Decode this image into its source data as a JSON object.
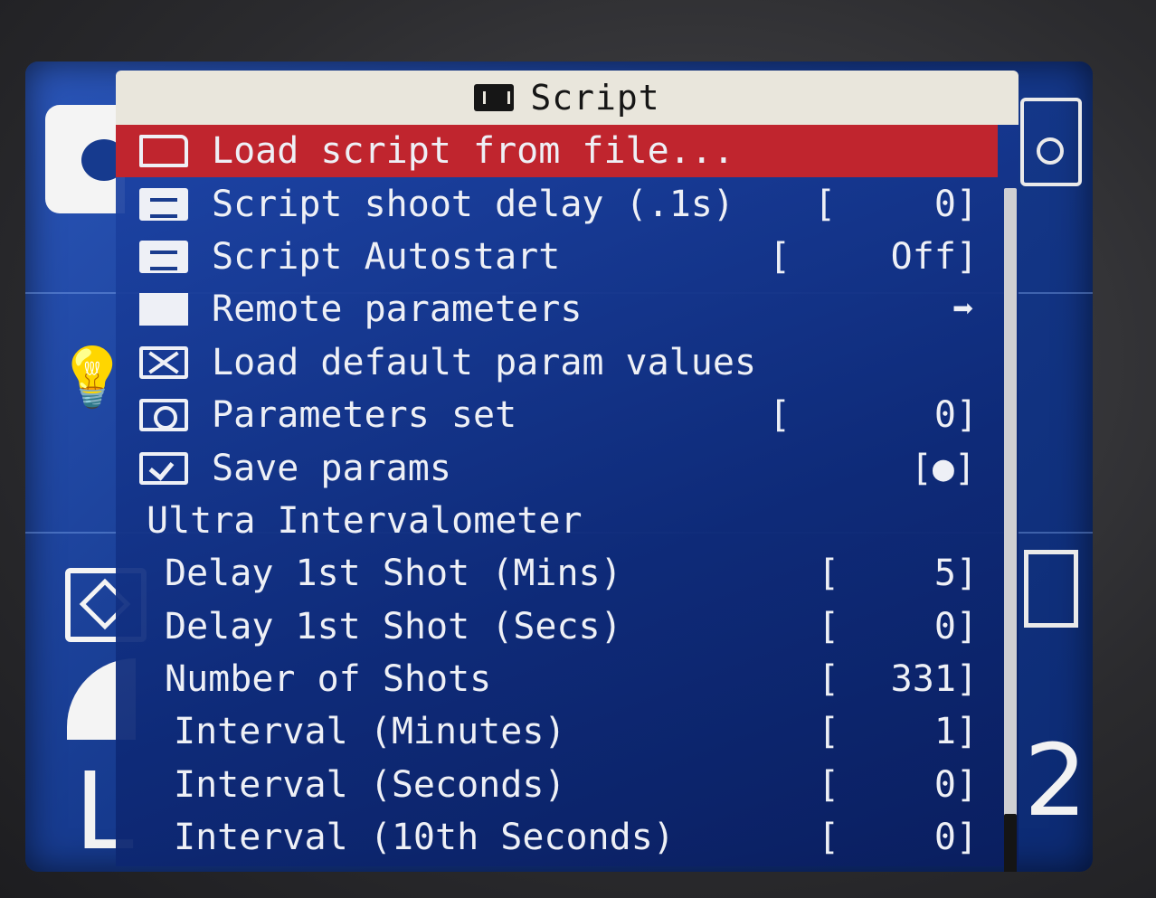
{
  "menu": {
    "title": "Script",
    "title_icon": "script-icon"
  },
  "rows": [
    {
      "label": "Load script from file...",
      "value": "",
      "icon": "folder-icon",
      "selected": true
    },
    {
      "label": "Script shoot delay (.1s)",
      "bracket": "[",
      "value": "0]",
      "icon": "value-icon"
    },
    {
      "label": "Script Autostart",
      "bracket": "[",
      "value": "Off]",
      "icon": "value-icon"
    },
    {
      "label": "Remote parameters",
      "arrow": "➡",
      "icon": "remote-icon"
    },
    {
      "label": "Load default param values",
      "icon": "reset-icon"
    },
    {
      "label": "Parameters set",
      "bracket": "[",
      "value": "0]",
      "icon": "cycle-icon"
    },
    {
      "label": "Save params",
      "value": "[●]",
      "icon": "checkbox-icon"
    },
    {
      "label": "Ultra Intervalometer"
    },
    {
      "label": "Delay 1st Shot (Mins)",
      "bracket": "[",
      "value": "5]"
    },
    {
      "label": "Delay 1st Shot (Secs)",
      "bracket": "[",
      "value": "0]"
    },
    {
      "label": "Number of Shots",
      "bracket": "[",
      "value": "331]"
    },
    {
      "label": "Interval (Minutes)",
      "bracket": "[",
      "value": "1]"
    },
    {
      "label": "Interval (Seconds)",
      "bracket": "[",
      "value": "0]"
    },
    {
      "label": "Interval (10th Seconds)",
      "bracket": "[",
      "value": "0]"
    }
  ],
  "background": {
    "left_icons": [
      "camera-mode-icon",
      "white-balance-bulb-icon",
      "metering-icon",
      "image-size-icon"
    ],
    "size_letter": "L",
    "right_icons": [
      "camera-icon",
      "flash-icon"
    ],
    "right_digit": "2",
    "bulb_glyph": "💡"
  },
  "colors": {
    "selected_row": "#c0252e",
    "menu_bg": "#163a8e",
    "title_bar": "#e9e6dc",
    "text": "#eef0f6"
  }
}
